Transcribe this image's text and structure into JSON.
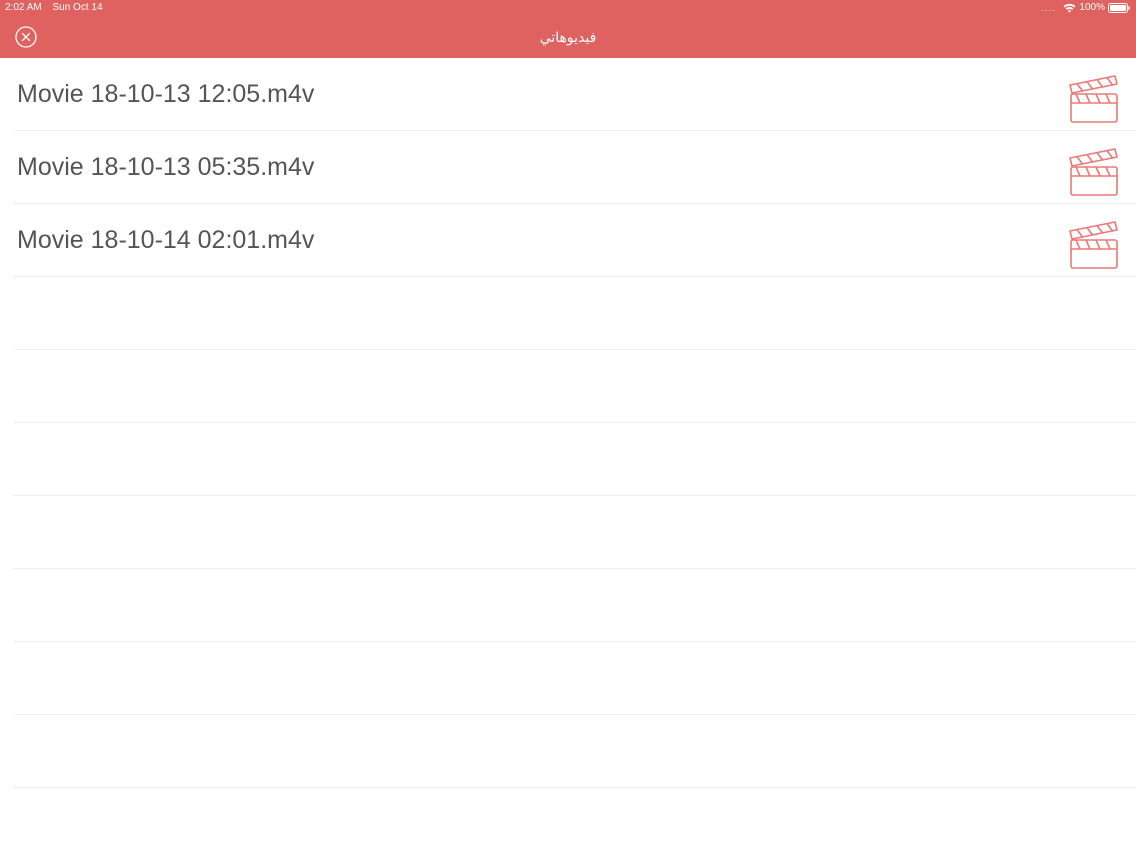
{
  "status_bar": {
    "time": "2:02 AM",
    "date": "Sun Oct 14",
    "signal": "....",
    "battery": "100%"
  },
  "nav": {
    "title": "فيديوهاتي",
    "close_icon": "close-circle-icon"
  },
  "colors": {
    "accent": "#df6160",
    "text": "#555555",
    "divider": "#eeeeee"
  },
  "files": [
    {
      "name": "Movie 18-10-13 12:05.m4v",
      "icon": "clapperboard-icon"
    },
    {
      "name": "Movie 18-10-13 05:35.m4v",
      "icon": "clapperboard-icon"
    },
    {
      "name": "Movie 18-10-14 02:01.m4v",
      "icon": "clapperboard-icon"
    }
  ]
}
